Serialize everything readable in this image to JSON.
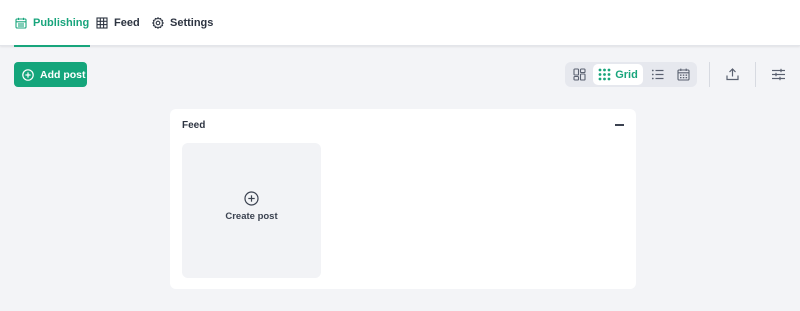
{
  "tabs": [
    {
      "label": "Publishing",
      "icon": "calendar-icon",
      "active": true
    },
    {
      "label": "Feed",
      "icon": "grid-table-icon",
      "active": false
    },
    {
      "label": "Settings",
      "icon": "gear-icon",
      "active": false
    }
  ],
  "toolbar": {
    "add_post_label": "Add post",
    "views": [
      {
        "name": "kanban",
        "icon": "kanban-icon",
        "active": false
      },
      {
        "name": "grid",
        "label": "Grid",
        "icon": "dots-grid-icon",
        "active": true
      },
      {
        "name": "list",
        "icon": "list-icon",
        "active": false
      },
      {
        "name": "calendar",
        "icon": "calendar-icon",
        "active": false
      }
    ],
    "export_icon": "export-icon",
    "filter_icon": "sliders-icon"
  },
  "panel": {
    "title": "Feed",
    "create_card_label": "Create post"
  },
  "colors": {
    "accent": "#18a57c",
    "background": "#f3f4f7",
    "text": "#2d3441"
  }
}
